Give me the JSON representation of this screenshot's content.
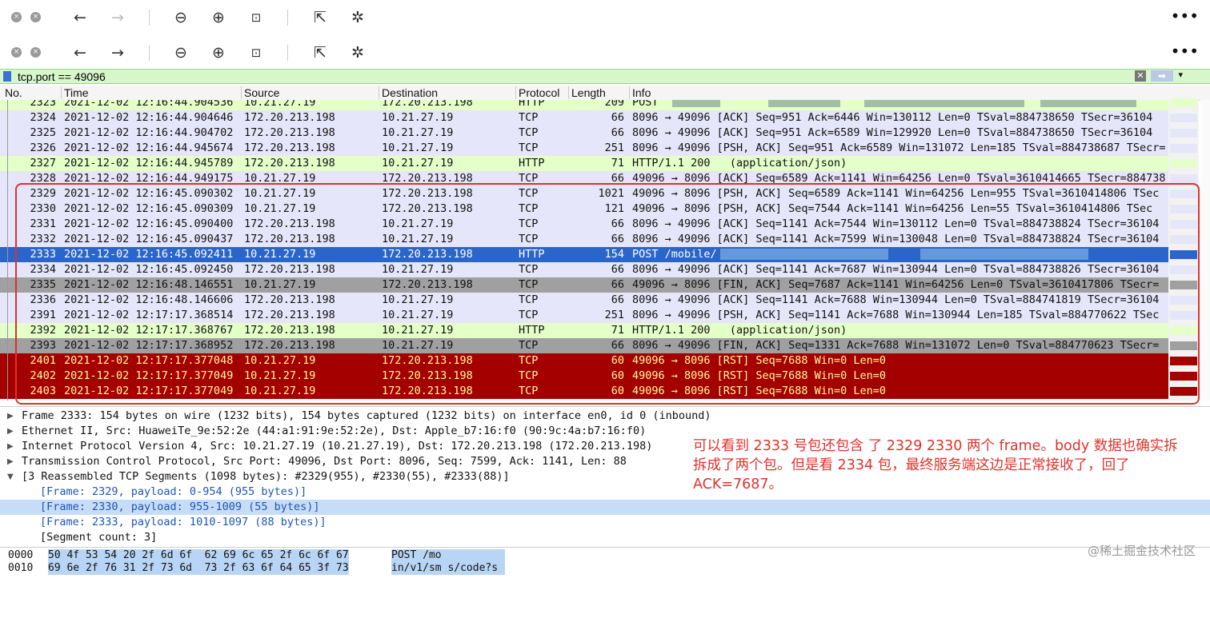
{
  "filter": {
    "value": "tcp.port == 49096"
  },
  "columns": [
    "No.",
    "Time",
    "Source",
    "Destination",
    "Protocol",
    "Length",
    "Info"
  ],
  "packets": [
    {
      "no": "2323",
      "time": "2021-12-02 12:16:44.904536",
      "src": "10.21.27.19",
      "dst": "172.20.213.198",
      "proto": "HTTP",
      "len": "209",
      "info": "POST",
      "kind": "http"
    },
    {
      "no": "2324",
      "time": "2021-12-02 12:16:44.904646",
      "src": "172.20.213.198",
      "dst": "10.21.27.19",
      "proto": "TCP",
      "len": "66",
      "info": "8096 → 49096 [ACK] Seq=951 Ack=6446 Win=130112 Len=0 TSval=884738650 TSecr=36104",
      "kind": "tcp"
    },
    {
      "no": "2325",
      "time": "2021-12-02 12:16:44.904702",
      "src": "172.20.213.198",
      "dst": "10.21.27.19",
      "proto": "TCP",
      "len": "66",
      "info": "8096 → 49096 [ACK] Seq=951 Ack=6589 Win=129920 Len=0 TSval=884738650 TSecr=36104",
      "kind": "tcp"
    },
    {
      "no": "2326",
      "time": "2021-12-02 12:16:44.945674",
      "src": "172.20.213.198",
      "dst": "10.21.27.19",
      "proto": "TCP",
      "len": "251",
      "info": "8096 → 49096 [PSH, ACK] Seq=951 Ack=6589 Win=131072 Len=185 TSval=884738687 TSecr=",
      "kind": "tcp"
    },
    {
      "no": "2327",
      "time": "2021-12-02 12:16:44.945789",
      "src": "172.20.213.198",
      "dst": "10.21.27.19",
      "proto": "HTTP",
      "len": "71",
      "info": "HTTP/1.1 200   (application/json)",
      "kind": "http"
    },
    {
      "no": "2328",
      "time": "2021-12-02 12:16:44.949175",
      "src": "10.21.27.19",
      "dst": "172.20.213.198",
      "proto": "TCP",
      "len": "66",
      "info": "49096 → 8096 [ACK] Seq=6589 Ack=1141 Win=64256 Len=0 TSval=3610414665 TSecr=884738",
      "kind": "tcp"
    },
    {
      "no": "2329",
      "time": "2021-12-02 12:16:45.090302",
      "src": "10.21.27.19",
      "dst": "172.20.213.198",
      "proto": "TCP",
      "len": "1021",
      "info": "49096 → 8096 [PSH, ACK] Seq=6589 Ack=1141 Win=64256 Len=955 TSval=3610414806 TSec",
      "kind": "tcp"
    },
    {
      "no": "2330",
      "time": "2021-12-02 12:16:45.090309",
      "src": "10.21.27.19",
      "dst": "172.20.213.198",
      "proto": "TCP",
      "len": "121",
      "info": "49096 → 8096 [PSH, ACK] Seq=7544 Ack=1141 Win=64256 Len=55 TSval=3610414806 TSec",
      "kind": "tcp"
    },
    {
      "no": "2331",
      "time": "2021-12-02 12:16:45.090400",
      "src": "172.20.213.198",
      "dst": "10.21.27.19",
      "proto": "TCP",
      "len": "66",
      "info": "8096 → 49096 [ACK] Seq=1141 Ack=7544 Win=130112 Len=0 TSval=884738824 TSecr=36104",
      "kind": "tcp"
    },
    {
      "no": "2332",
      "time": "2021-12-02 12:16:45.090437",
      "src": "172.20.213.198",
      "dst": "10.21.27.19",
      "proto": "TCP",
      "len": "66",
      "info": "8096 → 49096 [ACK] Seq=1141 Ack=7599 Win=130048 Len=0 TSval=884738824 TSecr=36104",
      "kind": "tcp"
    },
    {
      "no": "2333",
      "time": "2021-12-02 12:16:45.092411",
      "src": "10.21.27.19",
      "dst": "172.20.213.198",
      "proto": "HTTP",
      "len": "154",
      "info": "POST /mobile/",
      "kind": "sel"
    },
    {
      "no": "2334",
      "time": "2021-12-02 12:16:45.092450",
      "src": "172.20.213.198",
      "dst": "10.21.27.19",
      "proto": "TCP",
      "len": "66",
      "info": "8096 → 49096 [ACK] Seq=1141 Ack=7687 Win=130944 Len=0 TSval=884738826 TSecr=36104",
      "kind": "tcp"
    },
    {
      "no": "2335",
      "time": "2021-12-02 12:16:48.146551",
      "src": "10.21.27.19",
      "dst": "172.20.213.198",
      "proto": "TCP",
      "len": "66",
      "info": "49096 → 8096 [FIN, ACK] Seq=7687 Ack=1141 Win=64256 Len=0 TSval=3610417806 TSecr=",
      "kind": "fin"
    },
    {
      "no": "2336",
      "time": "2021-12-02 12:16:48.146606",
      "src": "172.20.213.198",
      "dst": "10.21.27.19",
      "proto": "TCP",
      "len": "66",
      "info": "8096 → 49096 [ACK] Seq=1141 Ack=7688 Win=130944 Len=0 TSval=884741819 TSecr=36104",
      "kind": "tcp"
    },
    {
      "no": "2391",
      "time": "2021-12-02 12:17:17.368514",
      "src": "172.20.213.198",
      "dst": "10.21.27.19",
      "proto": "TCP",
      "len": "251",
      "info": "8096 → 49096 [PSH, ACK] Seq=1141 Ack=7688 Win=130944 Len=185 TSval=884770622 TSec",
      "kind": "tcp"
    },
    {
      "no": "2392",
      "time": "2021-12-02 12:17:17.368767",
      "src": "172.20.213.198",
      "dst": "10.21.27.19",
      "proto": "HTTP",
      "len": "71",
      "info": "HTTP/1.1 200   (application/json)",
      "kind": "http"
    },
    {
      "no": "2393",
      "time": "2021-12-02 12:17:17.368952",
      "src": "172.20.213.198",
      "dst": "10.21.27.19",
      "proto": "TCP",
      "len": "66",
      "info": "8096 → 49096 [FIN, ACK] Seq=1331 Ack=7688 Win=131072 Len=0 TSval=884770623 TSecr=",
      "kind": "fin"
    },
    {
      "no": "2401",
      "time": "2021-12-02 12:17:17.377048",
      "src": "10.21.27.19",
      "dst": "172.20.213.198",
      "proto": "TCP",
      "len": "60",
      "info": "49096 → 8096 [RST] Seq=7688 Win=0 Len=0",
      "kind": "rst"
    },
    {
      "no": "2402",
      "time": "2021-12-02 12:17:17.377049",
      "src": "10.21.27.19",
      "dst": "172.20.213.198",
      "proto": "TCP",
      "len": "60",
      "info": "49096 → 8096 [RST] Seq=7688 Win=0 Len=0",
      "kind": "rst"
    },
    {
      "no": "2403",
      "time": "2021-12-02 12:17:17.377049",
      "src": "10.21.27.19",
      "dst": "172.20.213.198",
      "proto": "TCP",
      "len": "60",
      "info": "49096 → 8096 [RST] Seq=7688 Win=0 Len=0",
      "kind": "rst"
    }
  ],
  "details": [
    {
      "arrow": "▶",
      "text": "Frame 2333: 154 bytes on wire (1232 bits), 154 bytes captured (1232 bits) on interface en0, id 0 (inbound)"
    },
    {
      "arrow": "▶",
      "text": "Ethernet II, Src: HuaweiTe_9e:52:2e (44:a1:91:9e:52:2e), Dst: Apple_b7:16:f0 (90:9c:4a:b7:16:f0)"
    },
    {
      "arrow": "▶",
      "text": "Internet Protocol Version 4, Src: 10.21.27.19 (10.21.27.19), Dst: 172.20.213.198 (172.20.213.198)"
    },
    {
      "arrow": "▶",
      "text": "Transmission Control Protocol, Src Port: 49096, Dst Port: 8096, Seq: 7599, Ack: 1141, Len: 88"
    },
    {
      "arrow": "▼",
      "text": "[3 Reassembled TCP Segments (1098 bytes): #2329(955), #2330(55), #2333(88)]"
    }
  ],
  "segments": [
    "[Frame: 2329, payload: 0-954 (955 bytes)]",
    "[Frame: 2330, payload: 955-1009 (55 bytes)]",
    "[Frame: 2333, payload: 1010-1097 (88 bytes)]",
    "[Segment count: 3]"
  ],
  "annotation": "可以看到 2333 号包还包含 了 2329 2330 两个 frame。body 数据也确实拆拆成了两个包。但是看 2334 包，最终服务端这边是正常接收了，回了 ACK=7687。",
  "bytes": [
    {
      "offset": "0000",
      "hex": "50 4f 53 54 20 2f 6d 6f  62 69 6c 65 2f 6c 6f 67",
      "ascii": "POST /mo"
    },
    {
      "offset": "0010",
      "hex": "69 6e 2f 76 31 2f 73 6d  73 2f 63 6f 64 65 3f 73",
      "ascii": "in/v1/sm s/code?s"
    }
  ],
  "watermark": "@稀土掘金技术社区",
  "colors": {
    "tcp": "#e6e6fa",
    "http": "#e4ffc7",
    "fin": "#a0a0a0",
    "rst": "#a40000",
    "selected": "#2a66c9",
    "annotation": "#e2312b"
  }
}
